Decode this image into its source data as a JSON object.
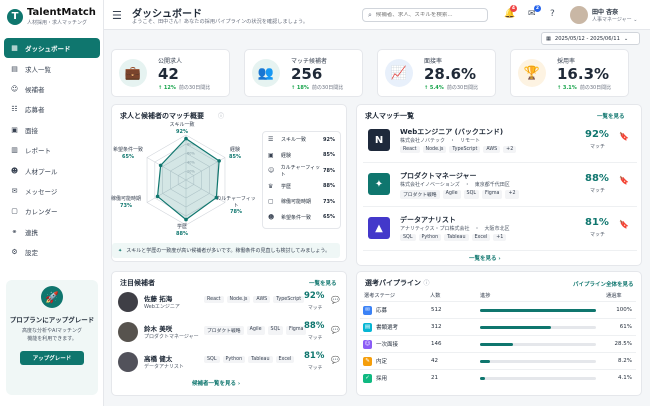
{
  "brand": {
    "name": "TalentMatch",
    "sub": "人材採用・求人マッチング"
  },
  "nav": [
    {
      "label": "ダッシュボード",
      "icon": "▦",
      "active": true
    },
    {
      "label": "求人一覧",
      "icon": "▤"
    },
    {
      "label": "候補者",
      "icon": "☺"
    },
    {
      "label": "応募者",
      "icon": "☷"
    },
    {
      "label": "面接",
      "icon": "▣"
    },
    {
      "label": "レポート",
      "icon": "▥"
    },
    {
      "label": "人材プール",
      "icon": "☻"
    },
    {
      "label": "メッセージ",
      "icon": "✉"
    },
    {
      "label": "カレンダー",
      "icon": "▢"
    },
    {
      "label": "連携",
      "icon": "⚭"
    },
    {
      "label": "設定",
      "icon": "⚙"
    }
  ],
  "upgrade": {
    "title": "プロプランにアップグレード",
    "desc1": "高度な分析やAIマッチング",
    "desc2": "機能を利用できます。",
    "button": "アップグレード"
  },
  "header": {
    "title": "ダッシュボード",
    "subtitle": "ようこそ、田中さん！あなたの採用パイプラインの状況を確認しましょう。",
    "search_placeholder": "候補者、求人、スキルを検索...",
    "notif_count": "4",
    "msg_count": "2",
    "user_name": "田中 杏奈",
    "user_role": "人事マネージャー",
    "date_range": "2025/05/12 - 2025/06/11"
  },
  "kpis": [
    {
      "label": "公開求人",
      "value": "42",
      "change": "↑ 12%",
      "period": "前の30日間比",
      "icon": "💼",
      "bg": "#e6f3f1",
      "fg": "#0f766e"
    },
    {
      "label": "マッチ候補者",
      "value": "256",
      "change": "↑ 18%",
      "period": "前の30日間比",
      "icon": "👥",
      "bg": "#e6f3f1",
      "fg": "#0f766e"
    },
    {
      "label": "面接率",
      "value": "28.6%",
      "change": "↑ 5.4%",
      "period": "前の30日間比",
      "icon": "📈",
      "bg": "#e8f0fb",
      "fg": "#2563eb"
    },
    {
      "label": "採用率",
      "value": "16.3%",
      "change": "↑ 3.1%",
      "period": "前の30日間比",
      "icon": "🏆",
      "bg": "#fdf3e2",
      "fg": "#d97706"
    }
  ],
  "radar": {
    "title": "求人と候補者のマッチ概要",
    "axes": [
      {
        "label": "スキル一致",
        "value": "92%"
      },
      {
        "label": "経験",
        "value": "85%"
      },
      {
        "label": "カルチャーフィット",
        "value": "78%"
      },
      {
        "label": "学歴",
        "value": "88%"
      },
      {
        "label": "稼働可能時期",
        "value": "73%"
      },
      {
        "label": "希望条件一致",
        "value": "65%"
      }
    ],
    "legend": [
      {
        "label": "スキル一致",
        "value": "92%",
        "icon": "☰"
      },
      {
        "label": "経験",
        "value": "85%",
        "icon": "▣"
      },
      {
        "label": "カルチャーフィット",
        "value": "78%",
        "icon": "☺"
      },
      {
        "label": "学歴",
        "value": "88%",
        "icon": "♛"
      },
      {
        "label": "稼働可能時期",
        "value": "73%",
        "icon": "▢"
      },
      {
        "label": "希望条件一致",
        "value": "65%",
        "icon": "☻"
      }
    ],
    "hint": "スキルと学歴の一致度が高い候補者が多いです。稼働条件の見直しも検討してみましょう。",
    "ticks": [
      "80%",
      "60%",
      "40%",
      "20%"
    ]
  },
  "matches": {
    "title": "求人マッチ一覧",
    "link": "一覧を見る",
    "more": "一覧を見る ›",
    "score_label": "マッチ",
    "items": [
      {
        "title": "Webエンジニア (バックエンド)",
        "company": "株式会社ノバテック　・　リモート",
        "tags": [
          "React",
          "Node.js",
          "TypeScript",
          "AWS",
          "+2"
        ],
        "score": "92%",
        "logo": "N",
        "color": "#1e293b"
      },
      {
        "title": "プロダクトマネージャー",
        "company": "株式会社イノベーションズ　・　東京都千代田区",
        "tags": [
          "プロダクト戦略",
          "Agile",
          "SQL",
          "Figma",
          "+2"
        ],
        "score": "88%",
        "logo": "✦",
        "color": "#0f766e"
      },
      {
        "title": "データアナリスト",
        "company": "アナリティクス・プロ株式会社　・　大阪市北区",
        "tags": [
          "SQL",
          "Python",
          "Tableau",
          "Excel",
          "+1"
        ],
        "score": "81%",
        "logo": "▲",
        "color": "#4338ca"
      }
    ]
  },
  "candidates": {
    "title": "注目候補者",
    "link": "一覧を見る",
    "more": "候補者一覧を見る ›",
    "score_label": "マッチ",
    "items": [
      {
        "name": "佐藤 拓海",
        "role": "Webエンジニア",
        "tags": [
          "React",
          "Node.js",
          "AWS",
          "TypeScript"
        ],
        "score": "92%",
        "av": "#3f3f46"
      },
      {
        "name": "鈴木 美咲",
        "role": "プロダクトマネージャー",
        "tags": [
          "プロダクト戦略",
          "Agile",
          "SQL",
          "Figma"
        ],
        "score": "88%",
        "av": "#57534e"
      },
      {
        "name": "高橋 健太",
        "role": "データアナリスト",
        "tags": [
          "SQL",
          "Python",
          "Tableau",
          "Excel"
        ],
        "score": "81%",
        "av": "#52525b"
      }
    ]
  },
  "pipeline": {
    "title": "選考パイプライン",
    "link": "パイプライン全体を見る",
    "cols": {
      "stage": "選考ステージ",
      "count": "人数",
      "progress": "進捗",
      "rate": "通過率"
    },
    "rows": [
      {
        "stage": "応募",
        "count": "512",
        "rate": "100%",
        "ratio": 1.0,
        "color": "#3b82f6",
        "icon": "✉"
      },
      {
        "stage": "書類選考",
        "count": "312",
        "rate": "61%",
        "ratio": 0.61,
        "color": "#06b6d4",
        "icon": "▤"
      },
      {
        "stage": "一次面接",
        "count": "146",
        "rate": "28.5%",
        "ratio": 0.285,
        "color": "#8b5cf6",
        "icon": "☺"
      },
      {
        "stage": "内定",
        "count": "42",
        "rate": "8.2%",
        "ratio": 0.082,
        "color": "#f59e0b",
        "icon": "✎"
      },
      {
        "stage": "採用",
        "count": "21",
        "rate": "4.1%",
        "ratio": 0.041,
        "color": "#10b981",
        "icon": "✓"
      }
    ]
  }
}
